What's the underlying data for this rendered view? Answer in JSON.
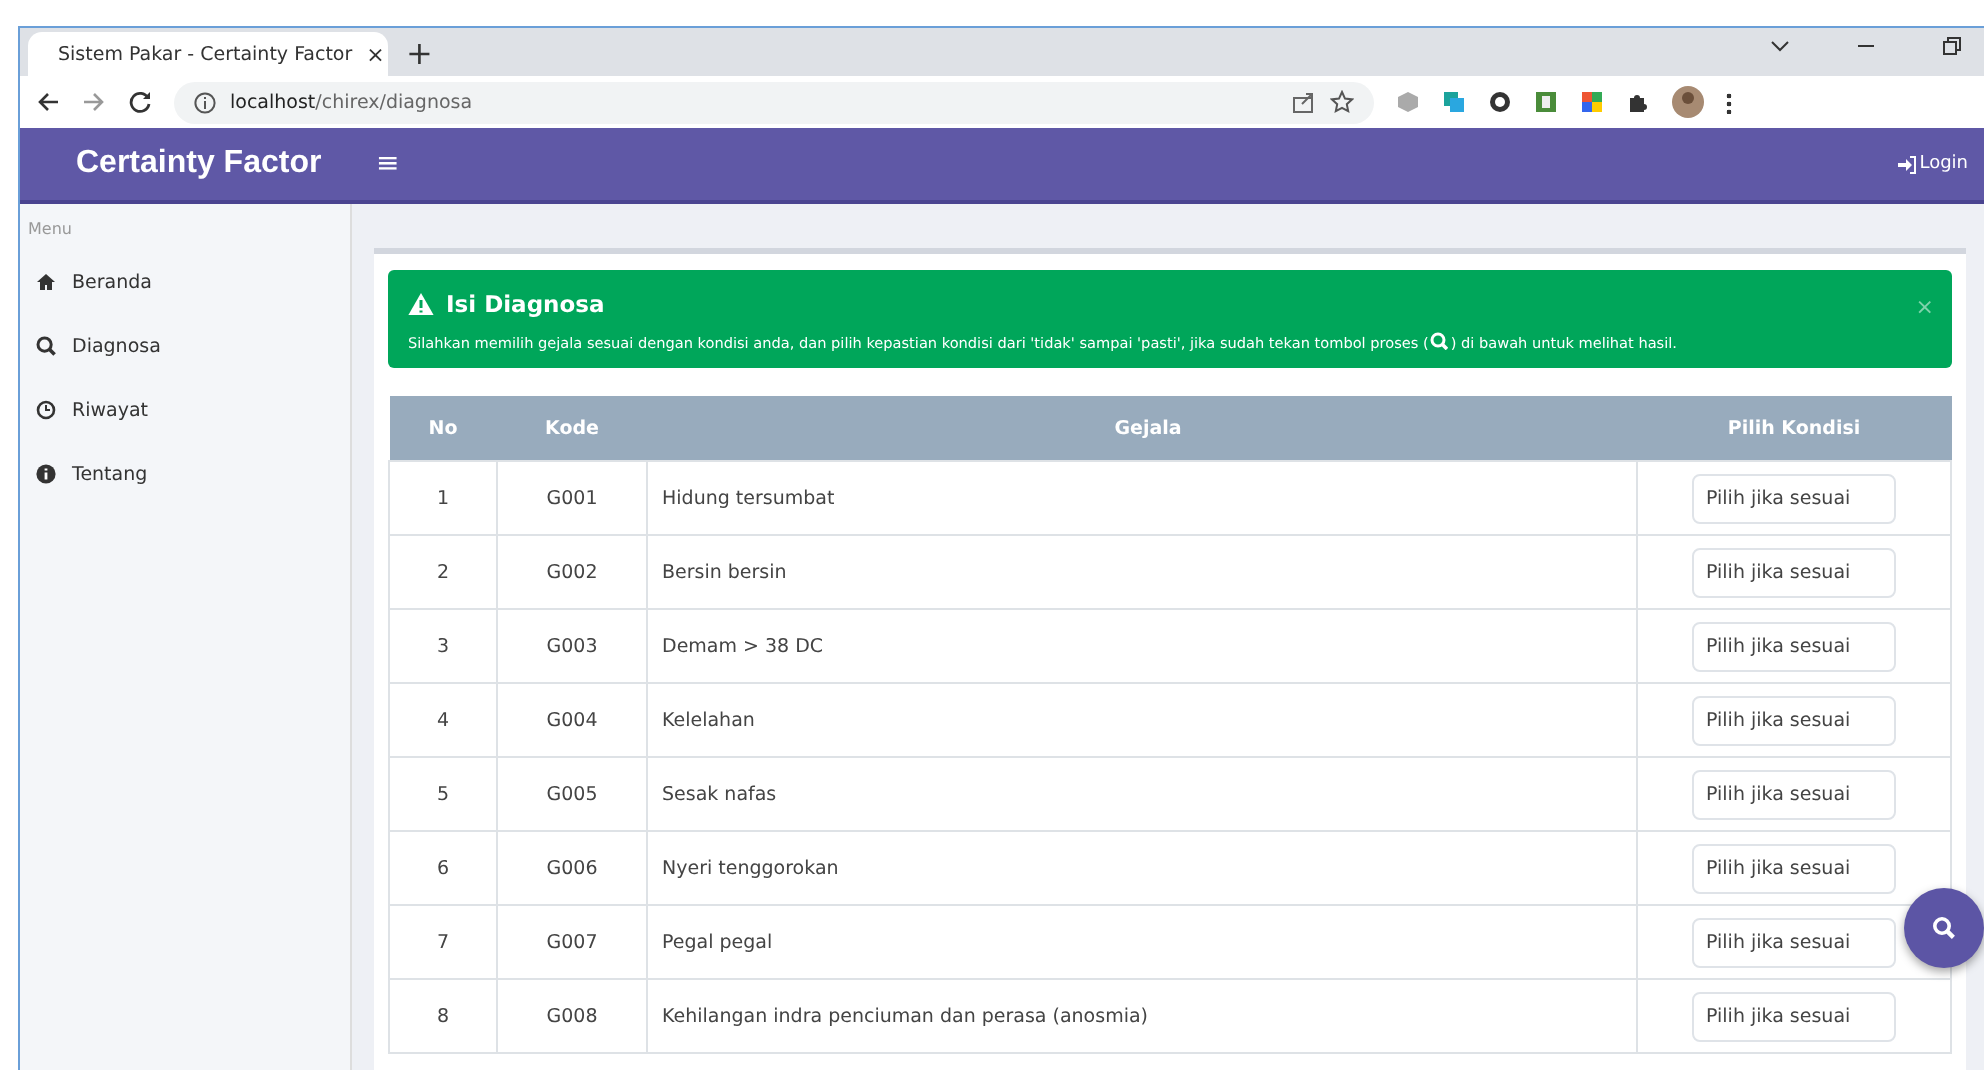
{
  "browser": {
    "tab_title": "Sistem Pakar - Certainty Factor",
    "tab_close": "×",
    "new_tab": "+",
    "url_host": "localhost",
    "url_path": "/chirex/diagnosa"
  },
  "header": {
    "brand": "Certainty Factor",
    "menu_toggle": "≡",
    "login": "Login"
  },
  "sidebar": {
    "heading": "Menu",
    "items": [
      {
        "label": "Beranda",
        "kind": "home",
        "selected": false
      },
      {
        "label": "Diagnosa",
        "kind": "search",
        "selected": false
      },
      {
        "label": "Riwayat",
        "kind": "history",
        "selected": false
      },
      {
        "label": "Tentang",
        "kind": "about",
        "selected": false
      }
    ]
  },
  "alert": {
    "title": "Isi Diagnosa",
    "close": "×",
    "text_before": "Silahkan memilih gejala sesuai dengan kondisi anda, dan pilih kepastian kondisi dari 'tidak' sampai 'pasti', jika sudah tekan tombol proses (",
    "text_after": ") di bawah untuk melihat hasil."
  },
  "table": {
    "columns": [
      "No",
      "Kode",
      "Gejala",
      "Pilih Kondisi"
    ],
    "rows": [
      {
        "no": "1",
        "kode": "G001",
        "gejala": "Hidung tersumbat",
        "kondisi": "Pilih jika sesuai"
      },
      {
        "no": "2",
        "kode": "G002",
        "gejala": "Bersin bersin",
        "kondisi": "Pilih jika sesuai"
      },
      {
        "no": "3",
        "kode": "G003",
        "gejala": "Demam > 38 DC",
        "kondisi": "Pilih jika sesuai"
      },
      {
        "no": "4",
        "kode": "G004",
        "gejala": "Kelelahan",
        "kondisi": "Pilih jika sesuai"
      },
      {
        "no": "5",
        "kode": "G005",
        "gejala": "Sesak nafas",
        "kondisi": "Pilih jika sesuai"
      },
      {
        "no": "6",
        "kode": "G006",
        "gejala": "Nyeri tenggorokan",
        "kondisi": "Pilih jika sesuai"
      },
      {
        "no": "7",
        "kode": "G007",
        "gejala": "Pegal pegal",
        "kondisi": "Pilih jika sesuai"
      },
      {
        "no": "8",
        "kode": "G008",
        "gejala": "Kehilangan indra penciuman dan perasa (anosmia)",
        "kondisi": "Pilih jika sesuai"
      }
    ]
  }
}
